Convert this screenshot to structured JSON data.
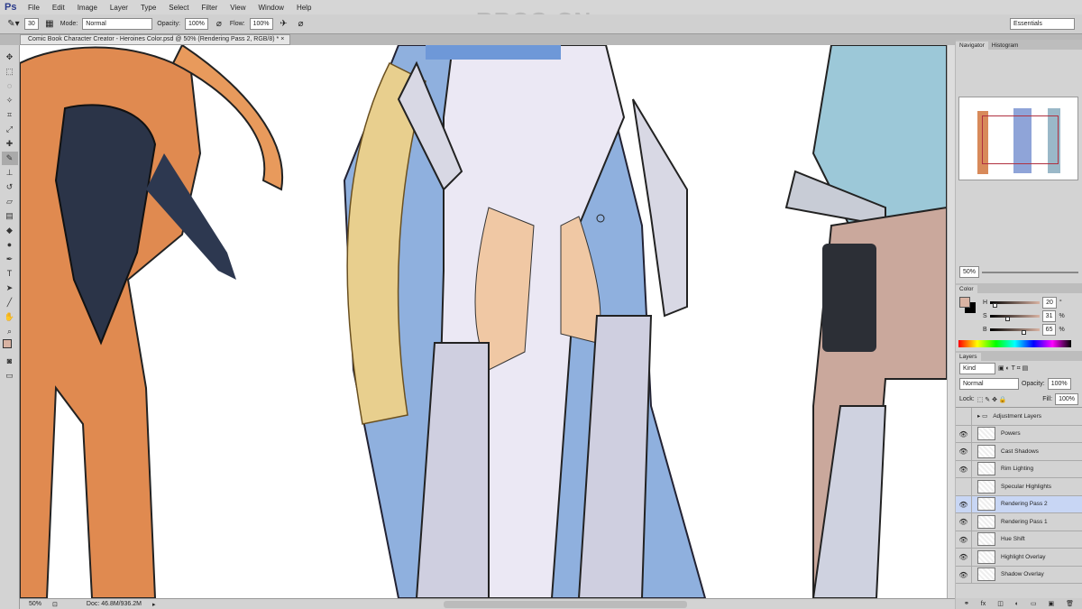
{
  "app": {
    "logo": "Ps",
    "watermark": "RRCG.CN"
  },
  "menu": [
    "File",
    "Edit",
    "Image",
    "Layer",
    "Type",
    "Select",
    "Filter",
    "View",
    "Window",
    "Help"
  ],
  "options": {
    "brush_size": "30",
    "mode_label": "Mode:",
    "mode": "Normal",
    "opacity_label": "Opacity:",
    "opacity": "100%",
    "flow_label": "Flow:",
    "flow": "100%",
    "workspace": "Essentials"
  },
  "document": {
    "tab": "Comic Book Character Creator - Heroines Color.psd @ 50% (Rendering Pass 2, RGB/8) *",
    "zoom": "50%",
    "doc_size": "Doc: 46.8M/936.2M"
  },
  "navigator": {
    "tabs": [
      "Navigator",
      "Histogram"
    ],
    "zoom": "50%"
  },
  "color": {
    "title": "Color",
    "channels": [
      {
        "label": "H",
        "value": "20",
        "unit": "°",
        "level": 0.06
      },
      {
        "label": "S",
        "value": "31",
        "unit": "%",
        "level": 0.31
      },
      {
        "label": "B",
        "value": "65",
        "unit": "%",
        "level": 0.65
      }
    ],
    "foreground": "#d9b3a3",
    "background": "#000000"
  },
  "layers": {
    "title": "Layers",
    "filter": "Kind",
    "blend": "Normal",
    "opacity_label": "Opacity:",
    "opacity": "100%",
    "lock_label": "Lock:",
    "fill_label": "Fill:",
    "fill": "100%",
    "items": [
      {
        "name": "Adjustment Layers",
        "visible": false,
        "group": true
      },
      {
        "name": "Powers",
        "visible": true
      },
      {
        "name": "Cast Shadows",
        "visible": true
      },
      {
        "name": "Rim Lighting",
        "visible": true
      },
      {
        "name": "Specular Highlights",
        "visible": false
      },
      {
        "name": "Rendering Pass 2",
        "visible": true,
        "selected": true
      },
      {
        "name": "Rendering Pass 1",
        "visible": true
      },
      {
        "name": "Hue Shift",
        "visible": true
      },
      {
        "name": "Highlight Overlay",
        "visible": true
      },
      {
        "name": "Shadow Overlay",
        "visible": true
      }
    ]
  }
}
